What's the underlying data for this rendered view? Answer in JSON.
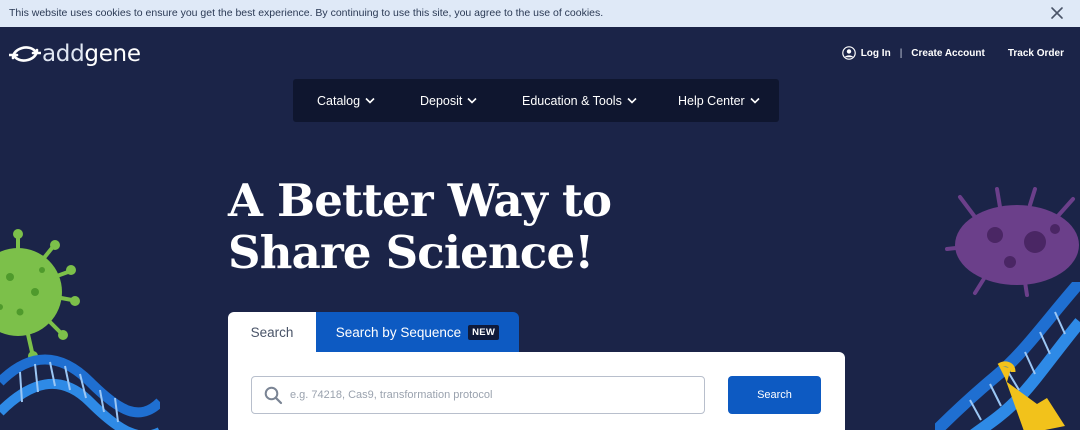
{
  "cookie_banner": {
    "text": "This website uses cookies to ensure you get the best experience. By continuing to use this site, you agree to the use of cookies.",
    "close_icon": "close-icon"
  },
  "brand": {
    "logo_icon": "addgene-swirl-icon",
    "name_prefix": "add",
    "name_suffix": "gene"
  },
  "account": {
    "user_icon": "user-circle-icon",
    "login": "Log In",
    "separator": "|",
    "create": "Create Account",
    "track": "Track Order"
  },
  "nav": {
    "items": [
      {
        "label": "Catalog"
      },
      {
        "label": "Deposit"
      },
      {
        "label": "Education & Tools"
      },
      {
        "label": "Help Center"
      }
    ],
    "dropdown_icon": "chevron-down-icon"
  },
  "hero": {
    "headline_line1": "A Better Way to",
    "headline_line2": "Share Science!"
  },
  "search": {
    "tabs": [
      {
        "label": "Search",
        "active": true
      },
      {
        "label": "Search by Sequence",
        "badge": "NEW",
        "active": false
      }
    ],
    "placeholder": "e.g. 74218, Cas9, transformation protocol",
    "button": "Search"
  },
  "colors": {
    "background": "#1b2448",
    "nav_background": "#0f162f",
    "accent_blue": "#0d5ac2",
    "cookie_banner": "#dfe9f7"
  }
}
